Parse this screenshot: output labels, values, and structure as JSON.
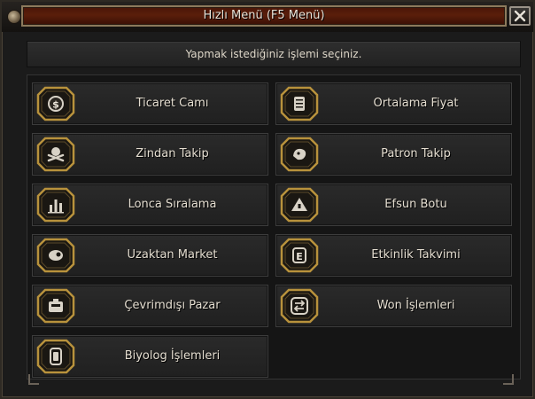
{
  "window": {
    "title": "Hızlı Menü (F5 Menü)",
    "close_glyph": "✕",
    "accent_color": "#5a1e0a",
    "border_gold": "#b8923c"
  },
  "instruction": "Yapmak istediğiniz işlemi seçiniz.",
  "menu": {
    "left": [
      {
        "label": "Ticaret Camı",
        "icon": "dollar-coin-icon",
        "glyph": "$"
      },
      {
        "label": "Zindan Takip",
        "icon": "skull-icon",
        "glyph": "☠"
      },
      {
        "label": "Lonca Sıralama",
        "icon": "bars-icon",
        "glyph": "▥"
      },
      {
        "label": "Uzaktan Market",
        "icon": "market-icon",
        "glyph": "◕"
      },
      {
        "label": "Çevrimdışı Pazar",
        "icon": "shop-icon",
        "glyph": "▣"
      },
      {
        "label": "Biyolog İşlemleri",
        "icon": "flask-icon",
        "glyph": "⚗"
      }
    ],
    "right": [
      {
        "label": "Ortalama Fiyat",
        "icon": "price-tag-icon",
        "glyph": "▤"
      },
      {
        "label": "Patron Takip",
        "icon": "boss-icon",
        "glyph": "◉"
      },
      {
        "label": "Efsun Botu",
        "icon": "enchant-icon",
        "glyph": "▲"
      },
      {
        "label": "Etkinlik Takvimi",
        "icon": "event-icon",
        "glyph": "E"
      },
      {
        "label": "Won İşlemleri",
        "icon": "exchange-icon",
        "glyph": "⇄"
      }
    ]
  }
}
